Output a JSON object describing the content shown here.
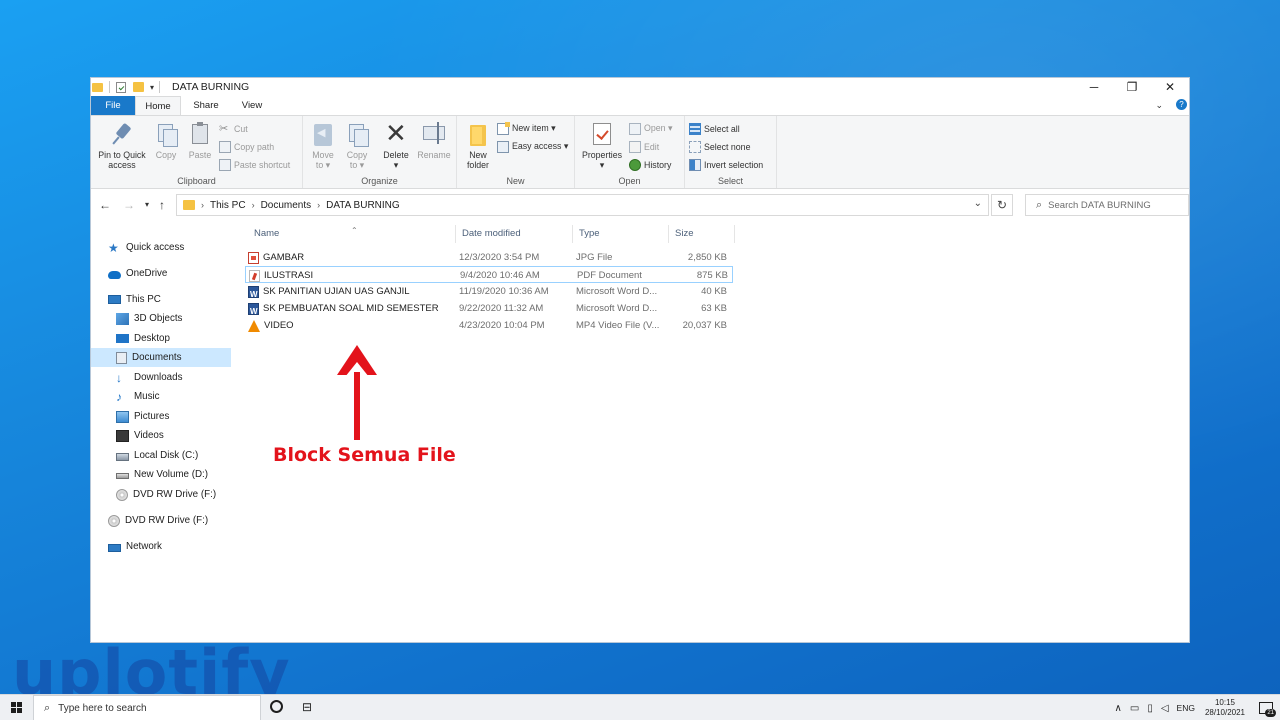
{
  "window": {
    "title": "DATA BURNING",
    "controls": {
      "minimize": "─",
      "maximize": "❐",
      "close": "✕"
    }
  },
  "tabs": [
    "File",
    "Home",
    "Share",
    "View"
  ],
  "ribbon": {
    "clipboard": {
      "label": "Clipboard",
      "pin_line1": "Pin to Quick",
      "pin_line2": "access",
      "copy": "Copy",
      "paste": "Paste",
      "cut": "Cut",
      "copy_path": "Copy path",
      "paste_shortcut": "Paste shortcut"
    },
    "organize": {
      "label": "Organize",
      "move_line1": "Move",
      "move_line2": "to ▾",
      "copy_line1": "Copy",
      "copy_line2": "to ▾",
      "delete_line1": "Delete",
      "delete_line2": "▾",
      "rename": "Rename"
    },
    "new": {
      "label": "New",
      "new_item": "New item ▾",
      "easy_access": "Easy access ▾",
      "new_folder_line1": "New",
      "new_folder_line2": "folder"
    },
    "open": {
      "label": "Open",
      "properties_line1": "Properties",
      "properties_line2": "▾",
      "open": "Open ▾",
      "edit": "Edit",
      "history": "History"
    },
    "select": {
      "label": "Select",
      "select_all": "Select all",
      "select_none": "Select none",
      "invert_selection": "Invert selection"
    }
  },
  "address": {
    "crumbs": [
      "This PC",
      "Documents",
      "DATA BURNING"
    ],
    "search_placeholder": "Search DATA BURNING"
  },
  "nav_pane": [
    {
      "label": "Quick access",
      "icon": "star-icon"
    },
    {
      "label": "OneDrive",
      "icon": "cloud-icon"
    },
    {
      "label": "This PC",
      "icon": "computer-icon"
    },
    {
      "label": "3D Objects",
      "icon": "cube-icon"
    },
    {
      "label": "Desktop",
      "icon": "desktop-icon"
    },
    {
      "label": "Documents",
      "icon": "document-icon",
      "selected": true
    },
    {
      "label": "Downloads",
      "icon": "download-icon"
    },
    {
      "label": "Music",
      "icon": "music-icon"
    },
    {
      "label": "Pictures",
      "icon": "picture-icon"
    },
    {
      "label": "Videos",
      "icon": "video-icon"
    },
    {
      "label": "Local Disk (C:)",
      "icon": "disk-icon"
    },
    {
      "label": "New Volume (D:)",
      "icon": "drive-icon"
    },
    {
      "label": "DVD RW Drive (F:)",
      "icon": "dvd-icon"
    },
    {
      "label": "DVD RW Drive (F:)",
      "icon": "dvd-icon"
    },
    {
      "label": "Network",
      "icon": "network-icon"
    }
  ],
  "columns": {
    "name": "Name",
    "date": "Date modified",
    "type": "Type",
    "size": "Size"
  },
  "files": [
    {
      "name": "GAMBAR",
      "date": "12/3/2020 3:54 PM",
      "type": "JPG File",
      "size": "2,850 KB",
      "icon": "jpg-file-icon"
    },
    {
      "name": "ILUSTRASI",
      "date": "9/4/2020 10:46 AM",
      "type": "PDF Document",
      "size": "875 KB",
      "icon": "pdf-file-icon"
    },
    {
      "name": "SK PANITIAN UJIAN UAS GANJIL",
      "date": "11/19/2020 10:36 AM",
      "type": "Microsoft Word D...",
      "size": "40 KB",
      "icon": "word-file-icon"
    },
    {
      "name": "SK PEMBUATAN SOAL MID SEMESTER",
      "date": "9/22/2020 11:32 AM",
      "type": "Microsoft Word D...",
      "size": "63 KB",
      "icon": "word-file-icon"
    },
    {
      "name": "VIDEO",
      "date": "4/23/2020 10:04 PM",
      "type": "MP4 Video File (V...",
      "size": "20,037 KB",
      "icon": "vlc-file-icon"
    }
  ],
  "annotation": {
    "text": "Block Semua File",
    "color": "#e3131b"
  },
  "watermark": "uplotify",
  "taskbar": {
    "search_placeholder": "Type here to search",
    "language": "ENG",
    "time": "10:15",
    "date": "28/10/2021",
    "notification_count": "21"
  },
  "colors": {
    "accent": "#1979ca",
    "selection": "#cce8ff",
    "desktop": "#1788dd"
  }
}
